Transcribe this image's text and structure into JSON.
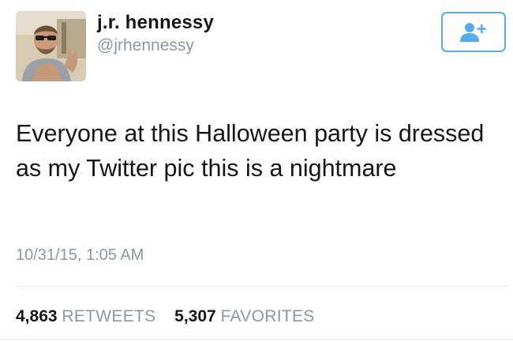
{
  "user": {
    "display_name": "j.r. hennessy",
    "handle": "@jrhennessy",
    "avatar_icon": "profile-photo"
  },
  "follow_button": {
    "icon": "follow-user-plus-icon",
    "color": "#55acee"
  },
  "tweet": {
    "text": "Everyone at this Halloween party is dressed as my Twitter pic this is a nightmare",
    "timestamp": "10/31/15, 1:05 AM"
  },
  "stats": {
    "retweets_count": "4,863",
    "retweets_label": "RETWEETS",
    "favorites_count": "5,307",
    "favorites_label": "FAVORITES"
  }
}
